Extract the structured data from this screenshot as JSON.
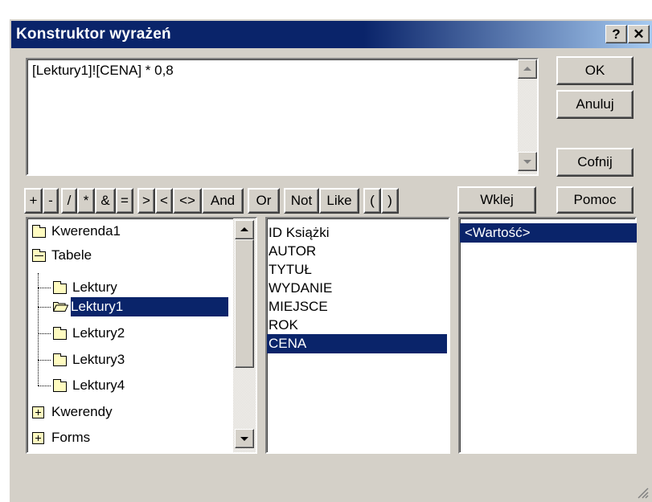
{
  "window": {
    "title": "Konstruktor wyrażeń",
    "help_icon": "?",
    "close_icon": "✕"
  },
  "expression": {
    "value": "[Lektury1]![CENA] * 0,8"
  },
  "buttons": {
    "ok": "OK",
    "cancel": "Anuluj",
    "undo": "Cofnij",
    "paste": "Wklej",
    "help": "Pomoc"
  },
  "operators": [
    "+",
    "-",
    "/",
    "*",
    "&",
    "=",
    ">",
    "<",
    "<>",
    "And",
    "Or",
    "Not",
    "Like",
    "(",
    ")"
  ],
  "tree": {
    "items": [
      {
        "label": "Kwerenda1",
        "icon": "folder-icon"
      },
      {
        "label": "Tabele",
        "icon": "folder-collapse-icon"
      },
      {
        "label": "Lektury",
        "icon": "folder-icon"
      },
      {
        "label": "Lektury1",
        "icon": "open-folder-icon",
        "selected": true
      },
      {
        "label": "Lektury2",
        "icon": "folder-icon"
      },
      {
        "label": "Lektury3",
        "icon": "folder-icon"
      },
      {
        "label": "Lektury4",
        "icon": "folder-icon"
      },
      {
        "label": "Kwerendy",
        "icon": "expand-icon"
      },
      {
        "label": "Forms",
        "icon": "expand-icon"
      }
    ]
  },
  "fields": {
    "items": [
      "ID Książki",
      "AUTOR",
      "TYTUŁ",
      "WYDANIE",
      "MIEJSCE",
      "ROK",
      "CENA"
    ],
    "selected": "CENA"
  },
  "values": {
    "items": [
      "<Wartość>"
    ],
    "selected": "<Wartość>"
  },
  "colors": {
    "selection": "#0a246a",
    "face": "#d4d0c8",
    "title_start": "#0a246a",
    "title_end": "#a6caf0"
  }
}
